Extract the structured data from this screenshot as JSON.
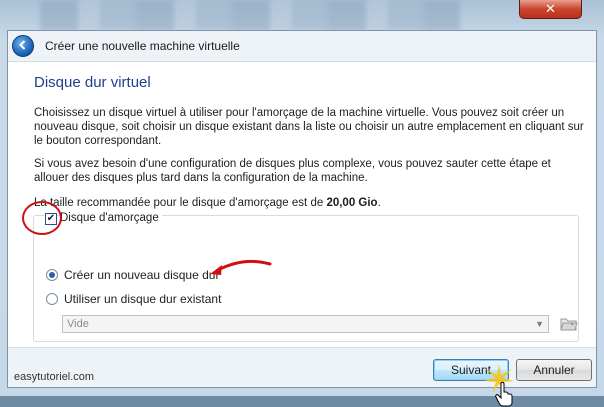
{
  "window": {
    "title": "Créer une nouvelle machine virtuelle",
    "close_glyph": "✕"
  },
  "page": {
    "heading": "Disque dur virtuel",
    "paragraph1": "Choisissez un disque virtuel à utiliser pour l'amorçage de la machine virtuelle. Vous pouvez soit créer un nouveau disque, soit choisir un disque existant dans la liste ou choisir un autre emplacement en cliquant sur le bouton correspondant.",
    "paragraph2": "Si vous avez besoin d'une configuration de disques plus complexe, vous pouvez sauter cette étape et allouer des disques plus tard dans la configuration de la machine.",
    "recommended_prefix": "La taille recommandée pour le disque d'amorçage est de ",
    "recommended_size": "20,00 Gio",
    "recommended_suffix": "."
  },
  "boot_disk": {
    "checkbox_label": "Disque d'amorçage",
    "checked": true,
    "option_new": "Créer un nouveau disque dur",
    "option_existing": "Utiliser un disque dur existant",
    "selected_option": "new",
    "existing_select_value": "Vide"
  },
  "buttons": {
    "next": "Suivant",
    "cancel": "Annuler"
  },
  "watermark": "easytutoriel.com",
  "icons": {
    "back": "back-arrow-icon",
    "folder": "folder-icon",
    "dropdown": "chevron-down-icon"
  },
  "colors": {
    "heading": "#1e3f8c",
    "annotation": "#d01010",
    "default_button": "#bee6fd"
  }
}
